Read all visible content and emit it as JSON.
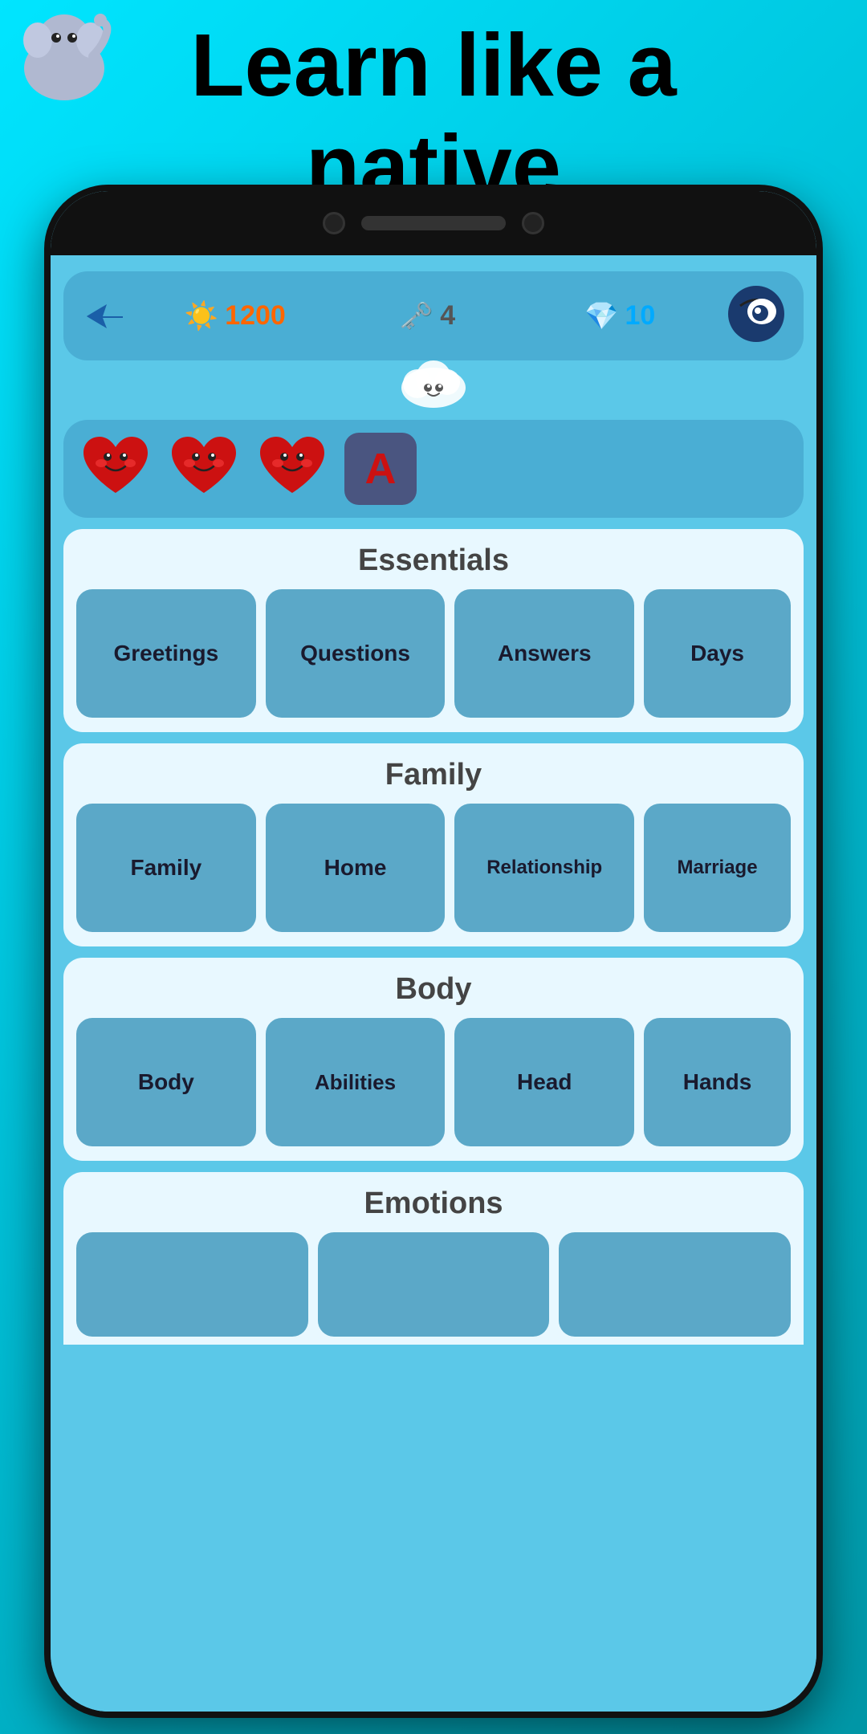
{
  "header": {
    "title_line1": "Learn like a",
    "title_line2": "native"
  },
  "stats": {
    "xp_icon": "☀️",
    "xp_value": "1200",
    "key_icon": "🗝",
    "key_value": "4",
    "gem_icon": "💎",
    "gem_value": "10"
  },
  "hearts": {
    "count": 3,
    "has_letter_box": true,
    "letter": "A"
  },
  "sections": [
    {
      "title": "Essentials",
      "items": [
        "Greetings",
        "Questions",
        "Answers",
        "Days"
      ]
    },
    {
      "title": "Family",
      "items": [
        "Family",
        "Home",
        "Relationship",
        "Marriage"
      ]
    },
    {
      "title": "Body",
      "items": [
        "Body",
        "Abilities",
        "Head",
        "Hands"
      ]
    },
    {
      "title": "Emotions",
      "items": []
    }
  ]
}
